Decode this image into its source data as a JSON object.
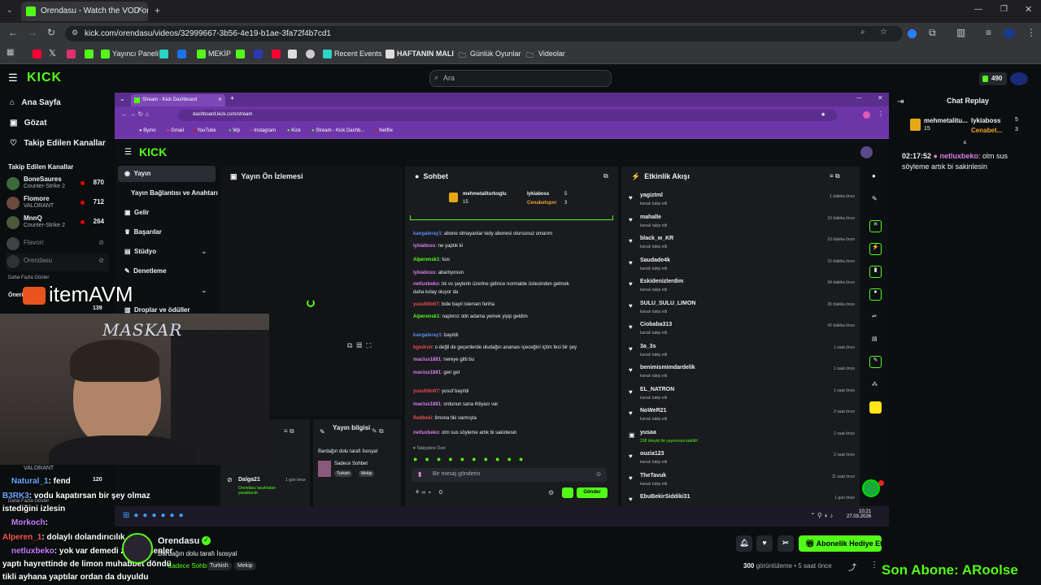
{
  "browser": {
    "tab_title": "Orendasu - Watch the VOD on",
    "url": "kick.com/orendasu/videos/32999667-3b56-4e19-b1ae-3fa72f4b7cd1",
    "bookmarks": [
      "Yayıncı Paneli",
      "MEKİP",
      "Recent Events",
      "HAFTANIN MALI",
      "Günlük Oyunlar",
      "Videolar"
    ]
  },
  "site": {
    "logo": "KICK",
    "search_placeholder": "Ara",
    "coins": "490",
    "nav": [
      "Ana Sayfa",
      "Gözat",
      "Takip Edilen Kanallar"
    ],
    "followed_title": "Takip Edilen Kanallar",
    "channels": [
      {
        "name": "BoneSaures",
        "game": "Counter-Strike 2",
        "viewers": "870"
      },
      {
        "name": "Flomore",
        "game": "VALORANT",
        "viewers": "712"
      },
      {
        "name": "MnnQ",
        "game": "Counter-Strike 2",
        "viewers": "264"
      },
      {
        "name": "Flavorr",
        "game": "",
        "viewers": ""
      },
      {
        "name": "Orendasu",
        "game": "",
        "viewers": ""
      }
    ],
    "show_more": "Daha Fazla Göster",
    "recommended": "Öneri",
    "rec_viewers": "139"
  },
  "inner": {
    "tab_title": "Stream - Kick Dashboard",
    "url": "dashboard.kick.com/stream",
    "bookmarks": [
      "Bymo",
      "Gmail",
      "YouTube",
      "Wp",
      "Instagram",
      "Kick",
      "Stream - Kick Dashb...",
      "Netflix"
    ],
    "logo": "KICK",
    "nav": [
      "Yayın",
      "Yayın Bağlantısı ve Anahtarı",
      "Gelir",
      "Başarılar",
      "Stüdyo",
      "Denetleme",
      "Droplar ve ödüller"
    ],
    "preview_title": "Yayın Ön İzlemesi",
    "chat_title": "Sohbet",
    "events_title": "Etkinlik Akışı",
    "chat_placeholder": "Bir mesaj gönderin",
    "send_label": "Gönder",
    "chat_count": "0",
    "top_gifters": [
      {
        "name": "mehmetaliturkoglu",
        "count": "15"
      },
      {
        "name": "lykiaboss",
        "count": "5"
      },
      {
        "name": "Cenabetspor",
        "count": "3"
      }
    ],
    "messages": [
      {
        "user": "kangaleray1",
        "text": ": abone olmayanlar tedy abonesi olursunuz umarım",
        "color": "#5b8def"
      },
      {
        "user": "lykiaboss",
        "text": ": ne yaptık ki",
        "color": "#d97ee8"
      },
      {
        "user": "Alperensk1",
        "text": ": kus",
        "color": "#53fc18"
      },
      {
        "user": "lykiaboss",
        "text": ": abartıyosun",
        "color": "#d97ee8"
      },
      {
        "user": "netluxbeko",
        "text": ": tık vs şeylerin üzerine gidince normalde üstesinden gelmek",
        "color": "#d97ee8"
      },
      {
        "user": "",
        "text": "daha kolay oluyor da",
        "color": "#efeff1"
      },
      {
        "user": "yusufdln07",
        "text": ": bide bayıl istersen feriha",
        "color": "#eb4d4b"
      },
      {
        "user": "Alperensk1",
        "text": ": naptınız otin adama yemek yiyip geldim",
        "color": "#53fc18"
      },
      {
        "user": "kangaleray1",
        "text": ": bayıldı",
        "color": "#5b8def"
      },
      {
        "user": "kgsdrsn",
        "text": ": o değil de geçenlerde uludağın ananası içeceğini içtim feci bir şey",
        "color": "#eb4d4b"
      },
      {
        "user": "macius1881",
        "text": ": nereye gitti bu",
        "color": "#d97ee8"
      },
      {
        "user": "macius1881",
        "text": ": geri gel",
        "color": "#d97ee8"
      },
      {
        "user": "yusufdln07",
        "text": ": yusuf bayıldı",
        "color": "#eb4d4b"
      },
      {
        "user": "macius1881",
        "text": ": ordunun sana ihtiyacı var",
        "color": "#d97ee8"
      },
      {
        "user": "Redbeki",
        "text": ": limona tiki varmışta",
        "color": "#eb4d4b"
      },
      {
        "user": "netluxbeko",
        "text": ": olm sus söyleme artık bi sakinlesin",
        "color": "#d97ee8"
      }
    ],
    "events": [
      {
        "name": "yagiztml",
        "sub": "kanalı takip etti",
        "time": "1 dakika önce"
      },
      {
        "name": "mahalle",
        "sub": "kanalı takip etti",
        "time": "10 dakika önce"
      },
      {
        "name": "black_w_KR",
        "sub": "kanalı takip etti",
        "time": "10 dakika önce"
      },
      {
        "name": "Saudade4k",
        "sub": "kanalı takip etti",
        "time": "15 dakika önce"
      },
      {
        "name": "Eskidenizlerdim",
        "sub": "kanalı takip etti",
        "time": "34 dakika önce"
      },
      {
        "name": "SULU_SULU_LIMON",
        "sub": "kanalı takip etti",
        "time": "35 dakika önce"
      },
      {
        "name": "Ciobaba313",
        "sub": "kanalı takip etti",
        "time": "42 dakika önce"
      },
      {
        "name": "3a_3s",
        "sub": "kanalı takip etti",
        "time": "1 saat önce"
      },
      {
        "name": "benimismimdardelik",
        "sub": "kanalı takip etti",
        "time": "1 saat önce"
      },
      {
        "name": "EL_NATRON",
        "sub": "kanalı takip etti",
        "time": "1 saat önce"
      },
      {
        "name": "NoWeR21",
        "sub": "kanalı takip etti",
        "time": "2 saat önce"
      },
      {
        "name": "yusaa",
        "sub": "318 izleyici ile yayınınıza katıldı!",
        "time": "2 saat önce"
      },
      {
        "name": "ouzia123",
        "sub": "kanalı takip etti",
        "time": "2 saat önce"
      },
      {
        "name": "TheTavuk",
        "sub": "kanalı takip etti",
        "time": "11 saat önce"
      },
      {
        "name": "EbuBekirSiddiki31",
        "sub": "",
        "time": "1 gün önce"
      }
    ],
    "stream_info_title": "Yayın bilgisi",
    "stream_title": "Bardağın dolu tarafı İsosyal",
    "category": "Sadece Sohbet",
    "tags": [
      "Turkish",
      "Mekip"
    ],
    "mod_user": "Dalga21",
    "mod_time": "1 gün önce",
    "mod_text": "Orendasu tarafından yasaklandı",
    "clock": "10:21",
    "date": "27.03.2026"
  },
  "replay": {
    "title": "Chat Replay",
    "gifters": [
      {
        "name": "mehmetalitu...",
        "count": "15"
      },
      {
        "name": "lykiaboss",
        "count": "5"
      },
      {
        "name": "Cenabet...",
        "count": "3"
      }
    ],
    "time": "02:17:52",
    "user": "netluxbeko",
    "text": ": olm sus söyleme artık bi sakinlesin"
  },
  "overlay": {
    "watermark": "itemAVM",
    "cam_label": "MASKAR",
    "lines": [
      {
        "user": "Natural_1",
        "text": ": fend",
        "color": "#66aaff"
      },
      {
        "user": "B3RK3",
        "text": ": vodu kapatırsan bir şey olmaz",
        "color": "#66aaff"
      },
      {
        "user": "",
        "text": "istediğini izlesin",
        "color": "#ffffff"
      },
      {
        "user": "Morkoch",
        "text": ":",
        "color": "#c77dff"
      },
      {
        "user": "Alperen_1",
        "text": ": dolaylı dolandırıcılık",
        "color": "#ff5555"
      },
      {
        "user": "netluxbeko",
        "text": ": yok var demedi zaten bilenler",
        "color": "#c77dff"
      },
      {
        "user": "",
        "text": "yaptı hayrettinde de limon muhabbet döndü",
        "color": "#ffffff"
      },
      {
        "user": "",
        "text": "tikli ayhana yaptılar ordan da duyuldu",
        "color": "#ffffff"
      }
    ],
    "sub_banner": "Son Abone: ARoolse"
  },
  "footer": {
    "channel": "Orendasu",
    "title": "Bardağın dolu tarafı İsosyal",
    "category": "Sadece Sohbet",
    "tags": [
      "Turkish",
      "Mekip"
    ],
    "views_count": "300",
    "views_label": "görüntüleme",
    "ago": "5 saat önce",
    "gift_label": "Abonelik Hediye Et"
  },
  "colors": {
    "kick_green": "#53fc18",
    "purple": "#6d36a8"
  }
}
